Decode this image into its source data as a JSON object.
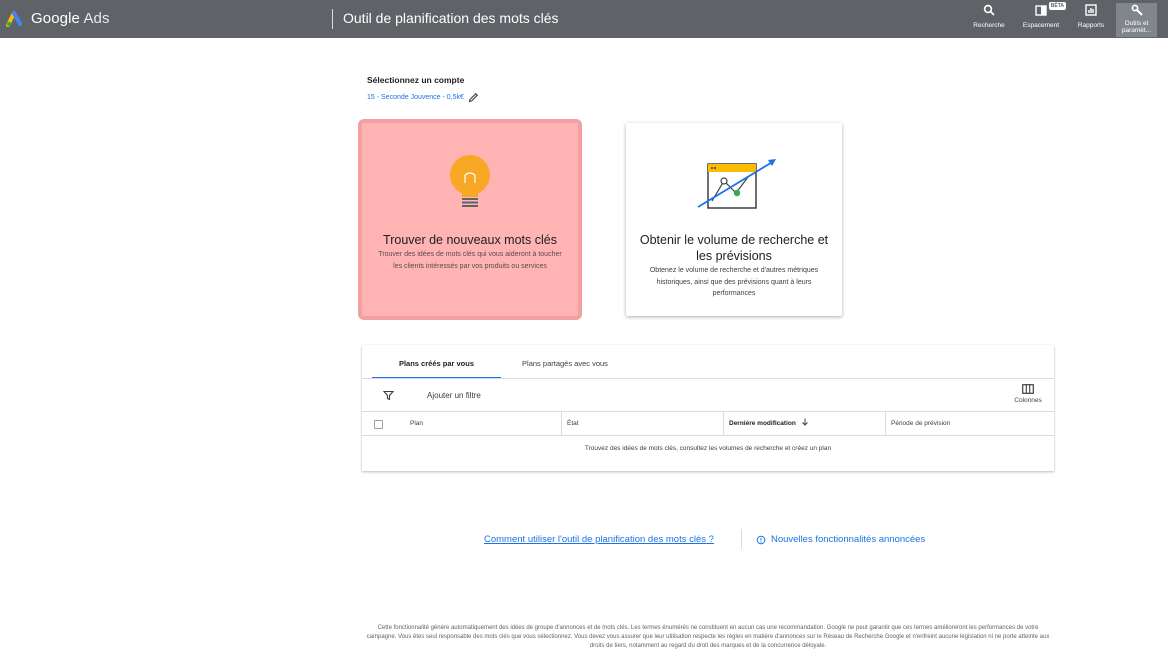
{
  "topbar": {
    "brand_google": "Google",
    "brand_ads": "Ads",
    "page_title": "Outil de planification des mots clés",
    "items": [
      {
        "label": "Recherche",
        "icon": "search-icon"
      },
      {
        "label": "Espacement",
        "icon": "spacing-icon",
        "badge": "BÊTA"
      },
      {
        "label": "Rapports",
        "icon": "reports-icon"
      },
      {
        "label": "Outils et paramèt...",
        "icon": "tools-icon",
        "active": true
      }
    ]
  },
  "account": {
    "title": "Sélectionnez un compte",
    "selected": "15 - Seconde Jouvence - 0,5k€"
  },
  "cards": [
    {
      "title": "Trouver de nouveaux mots clés",
      "description": "Trouver des idées de mots clés qui vous aideront à toucher les clients intéressés par vos produits ou services",
      "icon": "lightbulb-icon",
      "highlighted": true
    },
    {
      "title": "Obtenir le volume de recherche et les prévisions",
      "description": "Obtenez le volume de recherche et d'autres métriques historiques, ainsi que des prévisions quant à leurs performances",
      "icon": "trend-chart-icon",
      "highlighted": false
    }
  ],
  "plans": {
    "tabs": [
      "Plans créés par vous",
      "Plans partagés avec vous"
    ],
    "active_tab": 0,
    "filter_label": "Ajouter un filtre",
    "columns_label": "Colonnes",
    "headers": [
      "Plan",
      "État",
      "Dernière modification",
      "Période de prévision"
    ],
    "empty_message": "Trouvez des idées de mots clés, consultez les volumes de recherche et créez un plan"
  },
  "links": {
    "help": "Comment utiliser l'outil de planification des mots clés ?",
    "news": "Nouvelles fonctionnalités annoncées"
  },
  "footer": "Cette fonctionnalité génère automatiquement des idées de groupe d'annonces et de mots clés. Les termes énumérés ne constituent en aucun cas une recommandation. Google ne peut garantir que ces termes amélioreront les performances de votre campagne. Vous êtes seul responsable des mots clés que vous sélectionnez. Vous devez vous assurer que leur utilisation respecte les règles en matière d'annonces sur le Réseau de Recherche Google et n'enfreint aucune législation ni ne porte atteinte aux droits de tiers, notamment au regard du droit des marques et de la concurrence déloyale.",
  "colors": {
    "topbar": "#5f6368",
    "accent": "#1a73e8",
    "highlight": "#ffb3b3",
    "bulb": "#f9a825"
  }
}
